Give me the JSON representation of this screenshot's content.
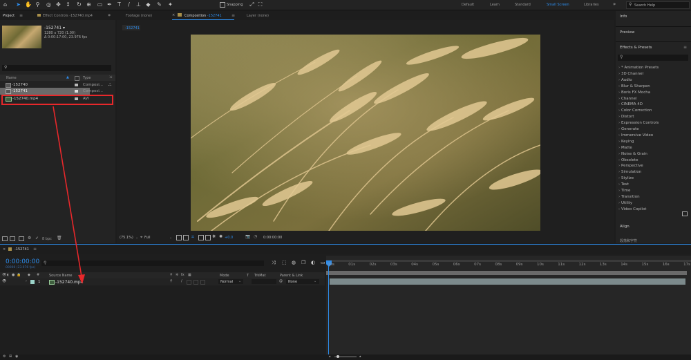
{
  "toolbar": {
    "snapping_label": "Snapping",
    "workspaces": [
      "Default",
      "Learn",
      "Standard",
      "Small Screen",
      "Libraries"
    ],
    "search_placeholder": "Search Help"
  },
  "project_panel": {
    "tab_label": "Project",
    "effect_controls_tab": "Effect Controls -152740.mp4",
    "selected_name": "-152741 ▾",
    "selected_info_1": "1280 x 720 (1.00)",
    "selected_info_2": "Δ 0:00:17:00, 23.976 fps",
    "col_name": "Name",
    "col_type": "Type",
    "items": [
      {
        "name": "-152740",
        "type": "Composi..."
      },
      {
        "name": "-152741",
        "type": "Composi..."
      },
      {
        "name": "-152740.mp4",
        "type": "AVI"
      }
    ],
    "bpc": "8 bpc"
  },
  "viewer": {
    "footage_tab": "Footage  (none)",
    "composition_tab_prefix": "Composition",
    "composition_tab_name": "-152741",
    "layer_tab": "Layer  (none)",
    "comp_chip": "-152741",
    "zoom": "(75.1%)",
    "resolution": "Full",
    "exposure": "+0.0",
    "timecode": "0:00:00:00"
  },
  "right_panels": {
    "info": "Info",
    "preview": "Preview",
    "effects_presets": "Effects & Presets",
    "effects": [
      "* Animation Presets",
      "3D Channel",
      "Audio",
      "Blur & Sharpen",
      "Boris FX Mocha",
      "Channel",
      "CINEMA 4D",
      "Color Correction",
      "Distort",
      "Expression Controls",
      "Generate",
      "Immersive Video",
      "Keying",
      "Matte",
      "Noise & Grain",
      "Obsolete",
      "Perspective",
      "Simulation",
      "Stylize",
      "Text",
      "Time",
      "Transition",
      "Utility",
      "Video Copilot"
    ],
    "align": "Align",
    "paragraph": "段落和字符"
  },
  "timeline": {
    "comp_tab": "-152741",
    "timecode": "0:00:00:00",
    "frames_info": "00000 (23.976 fps)",
    "headers": {
      "source_name": "Source Name",
      "mode": "Mode",
      "t": "T",
      "trkmat": "TrkMat",
      "parent": "Parent & Link"
    },
    "layer": {
      "index": "1",
      "name": "-152740.mp4",
      "mode": "Normal",
      "parent": "None"
    },
    "ruler": [
      "00s",
      "01s",
      "02s",
      "03s",
      "04s",
      "05s",
      "06s",
      "07s",
      "08s",
      "09s",
      "10s",
      "11s",
      "12s",
      "13s",
      "14s",
      "15s",
      "16s",
      "17s"
    ]
  },
  "annotation": {
    "color": "#e8282b"
  }
}
